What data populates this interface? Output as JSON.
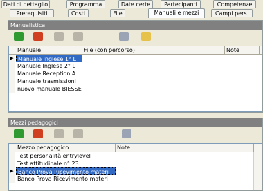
{
  "tabs_row1": [
    "Dati di dettaglio",
    "Programma",
    "Date certe",
    "Partecipanti",
    "Competenze"
  ],
  "tabs_row2": [
    "Prerequisiti",
    "Costi",
    "File",
    "Manuali e mezzi",
    "Campi pers."
  ],
  "active_tab": "Manuali e mezzi",
  "manualistica": {
    "header": "Manualistica",
    "toolbar_icons": [
      "add-icon",
      "delete-icon",
      "user-icon",
      "user-alt-icon",
      "grid-icon",
      "folder-open-icon"
    ],
    "columns": [
      "Manuale",
      "File (con percorso)",
      "Note"
    ],
    "rows": [
      {
        "name": "Manuale Inglese 1° L",
        "selected": true
      },
      {
        "name": "Manuale Inglese 2° L",
        "selected": false
      },
      {
        "name": "Manuale Reception  A",
        "selected": false
      },
      {
        "name": "Manuale trasmissioni",
        "selected": false
      },
      {
        "name": "nuovo manuale BIESSE",
        "selected": false
      }
    ]
  },
  "mezzi": {
    "header": "Mezzi pedagogici",
    "toolbar_icons": [
      "add-icon",
      "delete-icon",
      "user-icon",
      "user-alt-icon",
      "grid-icon"
    ],
    "columns": [
      "Mezzo pedagogico",
      "Note"
    ],
    "rows": [
      {
        "name": "Test personalità entrylevel",
        "selected": false
      },
      {
        "name": "Test attitudinale n° 23",
        "selected": false
      },
      {
        "name": "Banco Prova Ricevimento materi",
        "selected": true
      },
      {
        "name": "Banco Prova Ricevimento materi",
        "selected": false
      }
    ]
  },
  "colors": {
    "selection": "#316ac5",
    "header": "#808080",
    "add_icon": "#2f9a2f",
    "delete_icon": "#d04020"
  }
}
